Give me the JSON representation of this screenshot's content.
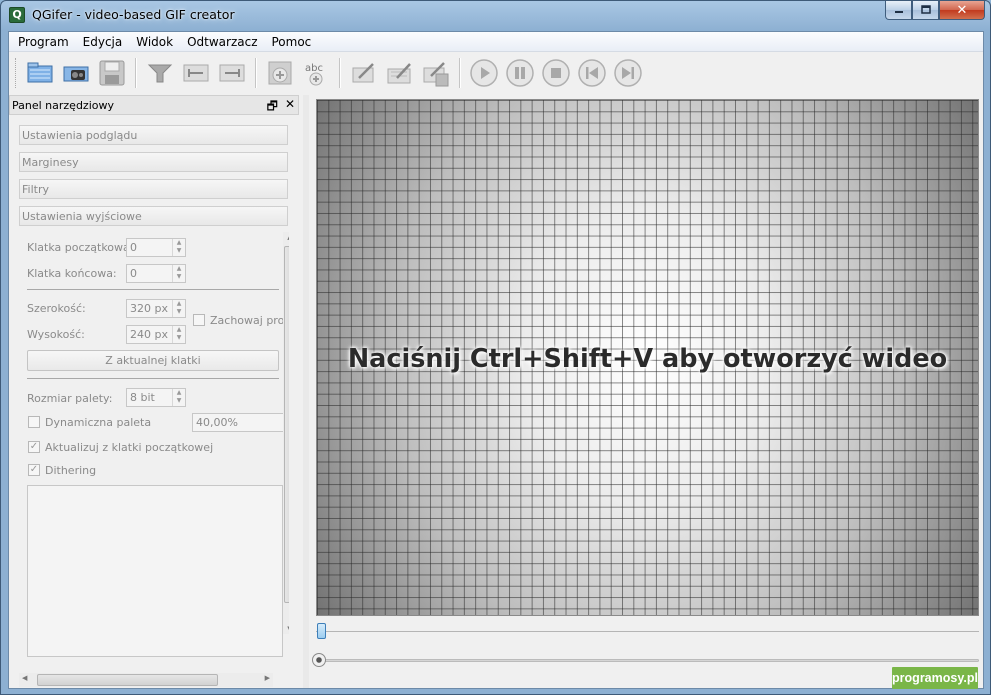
{
  "window": {
    "title": "QGifer - video-based GIF creator",
    "app_icon": "qgifer-icon",
    "controls": {
      "minimize": "–",
      "maximize": "□",
      "close": "✕"
    }
  },
  "menu": [
    "Program",
    "Edycja",
    "Widok",
    "Odtwarzacz",
    "Pomoc"
  ],
  "toolbar": {
    "groups": [
      [
        "open-video-icon",
        "extract-frames-icon",
        "save-gif-icon"
      ],
      [
        "filter-icon",
        "set-start-icon",
        "set-end-icon"
      ],
      [
        "add-object-icon",
        "add-text-icon"
      ],
      [
        "edit-icon",
        "edit-frames-icon",
        "edit-save-icon"
      ],
      [
        "play-icon",
        "pause-icon",
        "stop-icon",
        "previous-icon",
        "next-icon"
      ]
    ]
  },
  "dock": {
    "title": "Panel narzędziowy",
    "sections": [
      "Ustawienia podglądu",
      "Marginesy",
      "Filtry",
      "Ustawienia wyjściowe"
    ],
    "output": {
      "start_frame_label": "Klatka początkowa:",
      "start_frame_value": "0",
      "end_frame_label": "Klatka końcowa:",
      "end_frame_value": "0",
      "width_label": "Szerokość:",
      "width_value": "320 px",
      "height_label": "Wysokość:",
      "height_value": "240 px",
      "keep_ratio_label": "Zachowaj pro",
      "keep_ratio_checked": false,
      "from_frame_button": "Z aktualnej klatki",
      "palette_size_label": "Rozmiar palety:",
      "palette_size_value": "8 bit",
      "dynamic_palette_label": "Dynamiczna paleta",
      "dynamic_palette_checked": false,
      "dynamic_palette_value": "40,00%",
      "update_from_start_label": "Aktualizuj z klatki początkowej",
      "update_from_start_checked": true,
      "dithering_label": "Dithering",
      "dithering_checked": true
    }
  },
  "preview": {
    "message": "Naciśnij Ctrl+Shift+V aby otworzyć wideo"
  },
  "watermark": "programosy.pl",
  "colors": {
    "accent": "#3e7fb9",
    "watermark_bg": "#7ab648"
  }
}
